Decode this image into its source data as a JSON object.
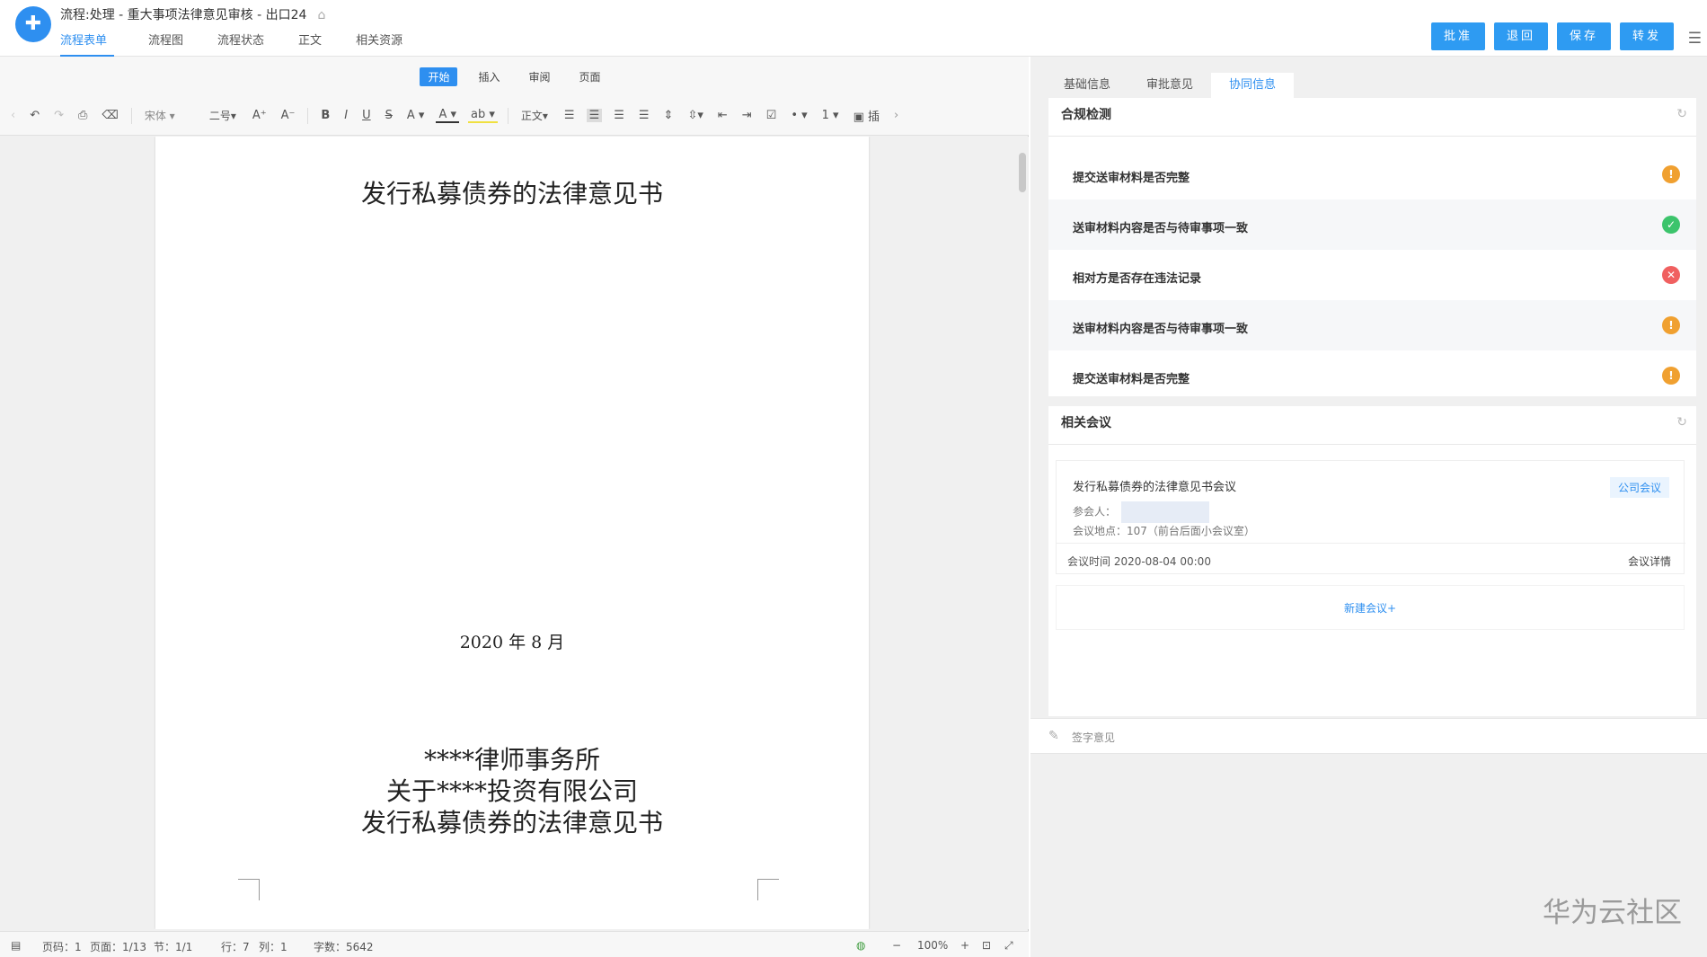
{
  "header": {
    "logo_glyph": "✚",
    "title": "流程:处理 - 重大事项法律意见审核 - 出口24",
    "tag_icon": "tag-icon",
    "tabs": [
      {
        "label": "流程表单"
      },
      {
        "label": "流程图"
      },
      {
        "label": "流程状态"
      },
      {
        "label": "正文"
      },
      {
        "label": "相关资源"
      }
    ],
    "actions": [
      {
        "label": "批准"
      },
      {
        "label": "退回"
      },
      {
        "label": "保存"
      },
      {
        "label": "转发"
      }
    ],
    "accent": "#2e8ff0"
  },
  "editor": {
    "ribbon_tabs": [
      {
        "label": "开始"
      },
      {
        "label": "插入"
      },
      {
        "label": "审阅"
      },
      {
        "label": "页面"
      }
    ],
    "toolbar": {
      "font": "宋体",
      "size": "二号",
      "style": "正文",
      "insert": "插"
    },
    "document": {
      "title": "发行私募债券的法律意见书",
      "date": "2020 年 8 月",
      "lines": [
        "****律师事务所",
        "关于****投资有限公司",
        "发行私募债券的法律意见书"
      ]
    },
    "status": {
      "page_no": "页码：1",
      "pages": "页面：1/13",
      "section": "节：1/1",
      "row": "行：7",
      "col": "列：1",
      "words": "字数：5642",
      "zoom": "100%"
    }
  },
  "sidebar": {
    "tabs": [
      {
        "label": "基础信息"
      },
      {
        "label": "审批意见"
      },
      {
        "label": "协同信息"
      }
    ],
    "compliance": {
      "title": "合规检测",
      "items": [
        {
          "label": "提交送审材料是否完整",
          "status": "warning",
          "glyph": "!",
          "color": "#f0a030"
        },
        {
          "label": "送审材料内容是否与待审事项一致",
          "status": "ok",
          "glyph": "✓",
          "color": "#3cc46c"
        },
        {
          "label": "相对方是否存在违法记录",
          "status": "error",
          "glyph": "✕",
          "color": "#f06060"
        },
        {
          "label": "送审材料内容是否与待审事项一致",
          "status": "warning",
          "glyph": "!",
          "color": "#f0a030"
        },
        {
          "label": "提交送审材料是否完整",
          "status": "warning",
          "glyph": "!",
          "color": "#f0a030"
        }
      ]
    },
    "meetings": {
      "title": "相关会议",
      "meeting": {
        "title": "发行私募债券的法律意见书会议",
        "tag": "公司会议",
        "participants_label": "参会人：",
        "location": "会议地点：107（前台后面小会议室）",
        "time": "会议时间 2020-08-04 00:00",
        "detail": "会议详情"
      },
      "new_meeting": "新建会议+"
    },
    "sign": {
      "label": "签字意见"
    }
  },
  "watermark": "华为云社区"
}
